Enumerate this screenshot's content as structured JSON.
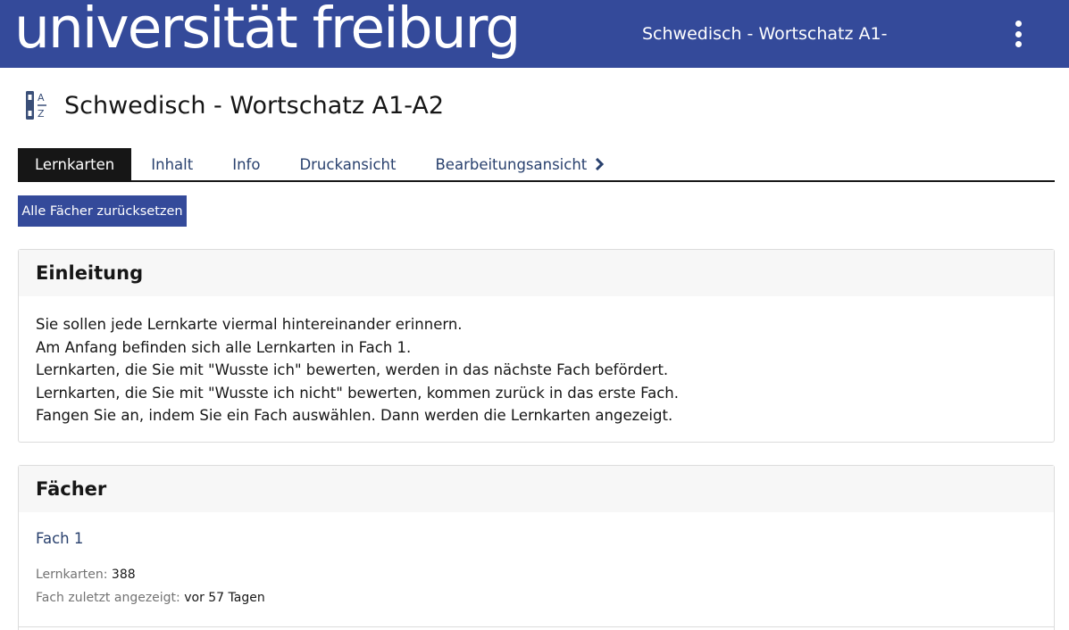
{
  "header": {
    "logo_text": "universität freiburg",
    "title": "Schwedisch - Wortschatz A1-",
    "menu_icon": "kebab-menu-icon",
    "background_color": "#344a9a"
  },
  "page": {
    "icon": "flashcards-az-icon",
    "title": "Schwedisch - Wortschatz A1-A2"
  },
  "tabs": [
    {
      "label": "Lernkarten",
      "active": true
    },
    {
      "label": "Inhalt",
      "active": false
    },
    {
      "label": "Info",
      "active": false
    },
    {
      "label": "Druckansicht",
      "active": false
    },
    {
      "label": "Bearbeitungsansicht",
      "active": false,
      "icon": "chevron-right-icon"
    }
  ],
  "actions": {
    "reset_label": "Alle Fächer zurücksetzen"
  },
  "intro": {
    "heading": "Einleitung",
    "lines": [
      "Sie sollen jede Lernkarte viermal hintereinander erinnern.",
      "Am Anfang befinden sich alle Lernkarten in Fach 1.",
      "Lernkarten, die Sie mit \"Wusste ich\" bewerten, werden in das nächste Fach befördert.",
      "Lernkarten, die Sie mit \"Wusste ich nicht\" bewerten, kommen zurück in das erste Fach.",
      "Fangen Sie an, indem Sie ein Fach auswählen. Dann werden die Lernkarten angezeigt."
    ]
  },
  "faecher": {
    "heading": "Fächer",
    "items": [
      {
        "name": "Fach 1",
        "count_label": "Lernkarten:",
        "count": "388",
        "last_label": "Fach zuletzt angezeigt:",
        "last_value": "vor 57 Tagen"
      }
    ]
  }
}
